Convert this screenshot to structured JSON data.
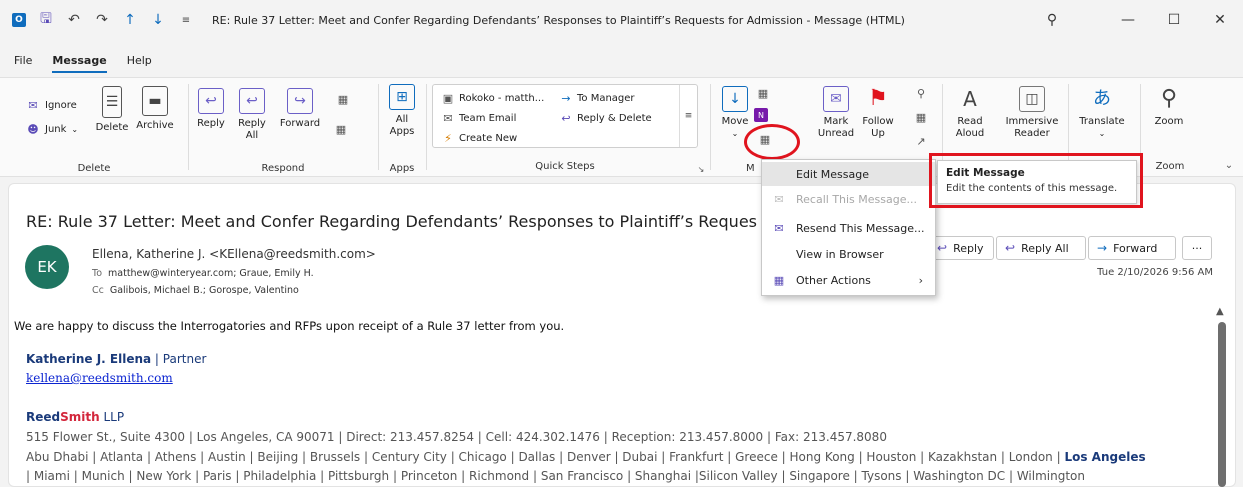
{
  "window": {
    "title": "RE: Rule 37 Letter: Meet and Confer Regarding Defendants’ Responses to Plaintiff’s Requests for Admission  -  Message (HTML)",
    "app_icon": "O"
  },
  "menu_tabs": [
    "File",
    "Message",
    "Help"
  ],
  "ribbon": {
    "delete_group": {
      "ignore": "Ignore",
      "junk": "Junk",
      "delete": "Delete",
      "archive": "Archive",
      "label": "Delete"
    },
    "respond_group": {
      "reply": "Reply",
      "reply_all_1": "Reply",
      "reply_all_2": "All",
      "forward": "Forward",
      "label": "Respond"
    },
    "apps_group": {
      "all_apps_1": "All",
      "all_apps_2": "Apps",
      "label": "Apps"
    },
    "quick_steps": {
      "rokoko": "Rokoko - matth...",
      "to_manager": "To Manager",
      "team_email": "Team Email",
      "reply_delete": "Reply & Delete",
      "create_new": "Create New",
      "label": "Quick Steps"
    },
    "move_group": {
      "move": "Move",
      "label": "M"
    },
    "tags_group": {
      "mark_unread_1": "Mark",
      "mark_unread_2": "Unread",
      "follow_up_1": "Follow",
      "follow_up_2": "Up"
    },
    "voice_group": {
      "read_aloud_1": "Read",
      "read_aloud_2": "Aloud",
      "immersive_1": "Immersive",
      "immersive_2": "Reader"
    },
    "translate": "Translate",
    "zoom": "Zoom",
    "zoom_label": "Zoom"
  },
  "message": {
    "subject": "RE: Rule 37 Letter: Meet and Confer Regarding Defendants’ Responses to Plaintiff’s Reques",
    "avatar_initials": "EK",
    "sender": "Ellena, Katherine J. <KEllena@reedsmith.com>",
    "to_label": "To",
    "to": "matthew@winteryear.com; Graue, Emily H.",
    "cc_label": "Cc",
    "cc": "Galibois, Michael B.; Gorospe, Valentino",
    "reply": "Reply",
    "reply_all": "Reply All",
    "forward": "Forward",
    "more": "···",
    "date": "Tue 2/10/2026 9:56 AM",
    "body": "We are happy to discuss the Interrogatories and RFPs upon receipt of a Rule 37 letter from you.",
    "sig_name": "Katherine J. Ellena",
    "sig_sep": " | ",
    "sig_role": "Partner",
    "sig_email": "kellena@reedsmith.com",
    "firm_reed": "Reed",
    "firm_smith": "Smith",
    "firm_llp": " LLP",
    "address": "515 Flower St., Suite 4300 | Los Angeles, CA 90071 | Direct: 213.457.8254 | Cell: 424.302.1476 | Reception: 213.457.8000 | Fax: 213.457.8080",
    "offices_line1": "Abu Dhabi | Atlanta | Athens | Austin | Beijing | Brussels | Century City | Chicago | Dallas | Denver | Dubai | Frankfurt | Greece | Hong Kong | Houston | Kazakhstan | London | ",
    "offices_line1_bold": "Los Angeles",
    "offices_line2": " | Miami | Munich | New York | Paris | Philadelphia | Pittsburgh | Princeton | Richmond | San Francisco | Shanghai |Silicon Valley | Singapore | Tysons | Washington DC | Wilmington"
  },
  "dropdown": {
    "edit_message": "Edit Message",
    "recall_message": "Recall This Message...",
    "resend_message": "Resend This Message...",
    "view_in_browser": "View in Browser",
    "other_actions": "Other Actions"
  },
  "tooltip": {
    "title": "Edit Message",
    "description": "Edit the contents of this message."
  }
}
